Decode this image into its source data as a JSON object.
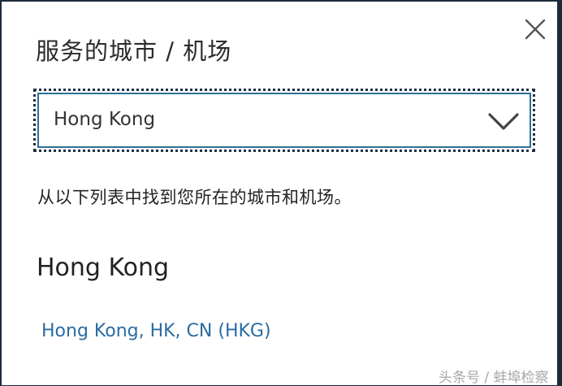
{
  "dialog": {
    "title": "服务的城市 / 机场",
    "close_icon": "close-icon"
  },
  "city_select": {
    "selected_value": "Hong Kong",
    "chevron_icon": "chevron-down-icon"
  },
  "helper_text": "从以下列表中找到您所在的城市和机场。",
  "results": {
    "city_heading": "Hong Kong",
    "airports": [
      {
        "label": "Hong Kong, HK, CN (HKG)"
      }
    ]
  },
  "watermark": "头条号 / 蚌埠检察",
  "colors": {
    "backdrop": "#1d2a3c",
    "link": "#2a6ba3",
    "select_border": "#2e6f94",
    "focus_outline": "#1f2f44"
  }
}
